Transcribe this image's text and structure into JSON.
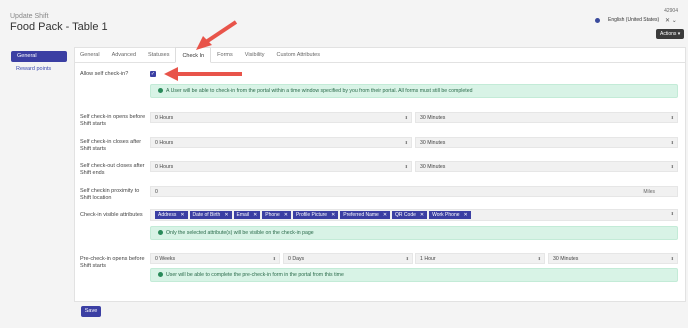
{
  "header": {
    "subtitle": "Update Shift",
    "title": "Food Pack - Table 1",
    "record_id": "42904"
  },
  "language": {
    "label": "English (United States)",
    "close": "✕",
    "chevron": "⌄"
  },
  "actions_label": "Actions ▾",
  "sidebar": {
    "items": [
      {
        "label": "General"
      },
      {
        "label": "Reward points"
      }
    ]
  },
  "tabs": [
    {
      "label": "General"
    },
    {
      "label": "Advanced"
    },
    {
      "label": "Statuses"
    },
    {
      "label": "Check In"
    },
    {
      "label": "Forms"
    },
    {
      "label": "Visibility"
    },
    {
      "label": "Custom Attributes"
    }
  ],
  "form": {
    "allow_self_checkin": {
      "label": "Allow self check-in?",
      "checked": true,
      "info": "A User will be able to check-in from the portal within a time window specified by you from their portal. All forms must still be completed"
    },
    "opens_before": {
      "label": "Self check-in opens before Shift starts",
      "hours": "0 Hours",
      "minutes": "30 Minutes"
    },
    "closes_after": {
      "label": "Self check-in closes after Shift starts",
      "hours": "0 Hours",
      "minutes": "30 Minutes"
    },
    "checkout_closes": {
      "label": "Self check-out closes after Shift ends",
      "hours": "0 Hours",
      "minutes": "30 Minutes"
    },
    "proximity": {
      "label": "Self checkin proximity to Shift location",
      "value": "0",
      "unit": "Miles"
    },
    "visible_attributes": {
      "label": "Check-in visible attributes",
      "tags": [
        "Address",
        "Date of Birth",
        "Email",
        "Phone",
        "Profile Picture",
        "Preferred Name",
        "QR Code",
        "Work Phone"
      ],
      "info": "Only the selected attribute(s) will be visible on the check-in page"
    },
    "precheckin": {
      "label": "Pre-check-in opens before Shift starts",
      "weeks": "0 Weeks",
      "days": "0 Days",
      "hours": "1 Hour",
      "minutes": "30 Minutes",
      "info": "User will be able to complete the pre-check-in form in the portal from this time"
    }
  },
  "save_label": "Save",
  "colors": {
    "accent": "#3b3fa3",
    "info_bg": "#d8f3e6",
    "annotation_arrow": "#e8544a"
  }
}
